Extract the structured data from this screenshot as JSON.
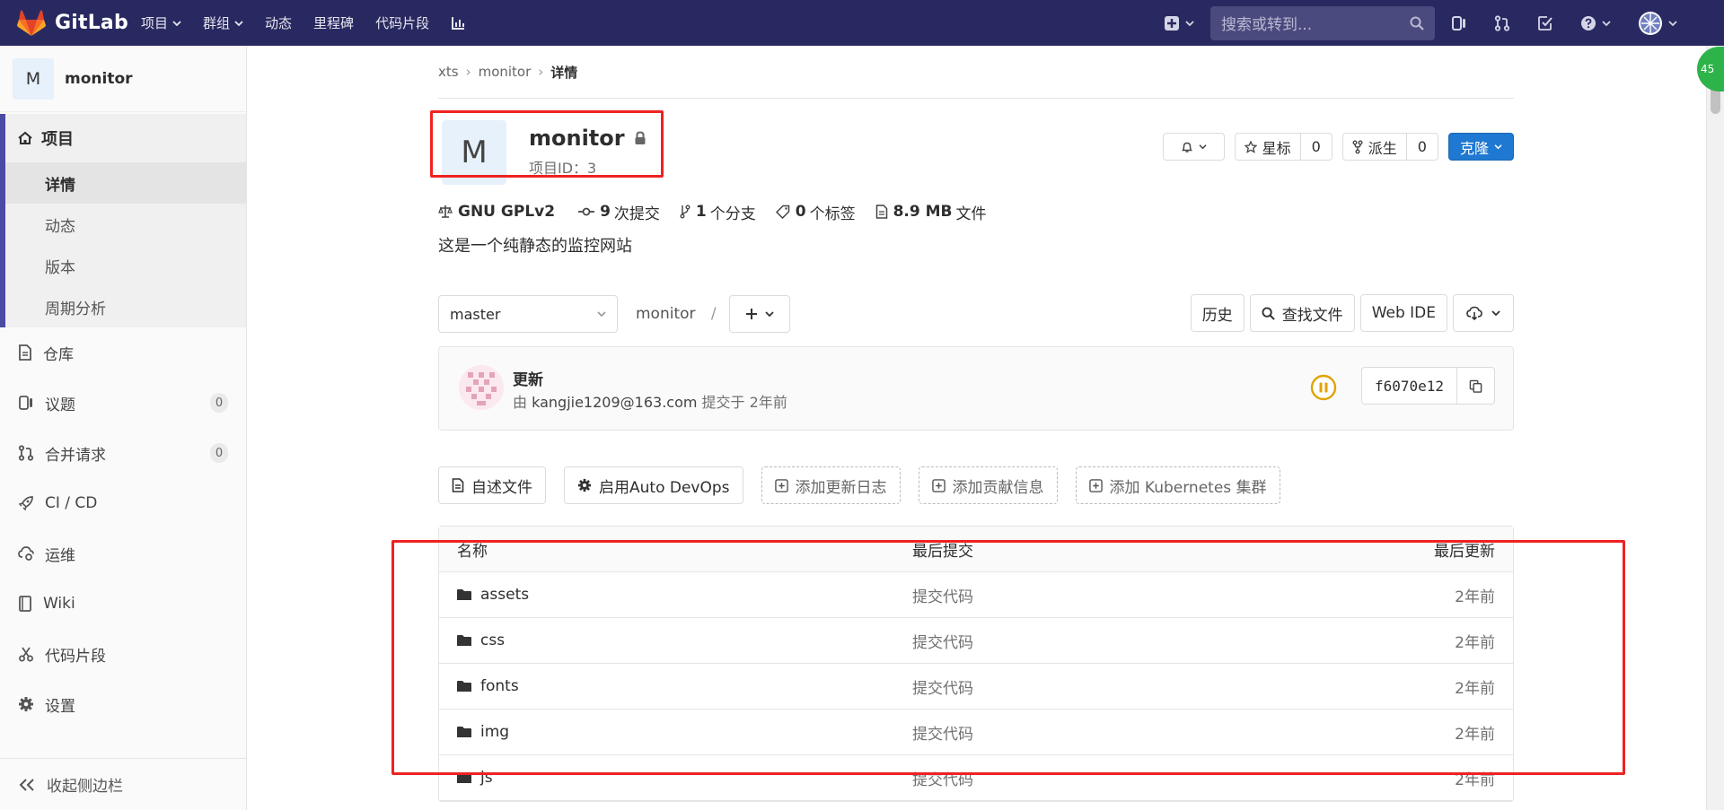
{
  "navbar": {
    "brand": "GitLab",
    "links": [
      "项目",
      "群组",
      "动态",
      "里程碑",
      "代码片段"
    ],
    "search_placeholder": "搜索或转到..."
  },
  "sidebar": {
    "avatar_letter": "M",
    "project_name": "monitor",
    "group_label": "项目",
    "sub_items": [
      "详情",
      "动态",
      "版本",
      "周期分析"
    ],
    "items": [
      {
        "label": "仓库"
      },
      {
        "label": "议题",
        "count": "0"
      },
      {
        "label": "合并请求",
        "count": "0"
      },
      {
        "label": "CI / CD"
      },
      {
        "label": "运维"
      },
      {
        "label": "Wiki"
      },
      {
        "label": "代码片段"
      },
      {
        "label": "设置"
      }
    ],
    "collapse_label": "收起侧边栏"
  },
  "breadcrumb": [
    "xts",
    "monitor",
    "详情"
  ],
  "project": {
    "avatar_letter": "M",
    "title": "monitor",
    "id_label": "项目ID：3",
    "star_label": "星标",
    "star_count": "0",
    "fork_label": "派生",
    "fork_count": "0",
    "clone_label": "克隆"
  },
  "stats": {
    "license": "GNU GPLv2",
    "commits_num": "9",
    "commits_label": "次提交",
    "branches_num": "1",
    "branches_label": "个分支",
    "tags_num": "0",
    "tags_label": "个标签",
    "size_num": "8.9 MB",
    "size_label": "文件"
  },
  "description": "这是一个纯静态的监控网站",
  "repo": {
    "branch": "master",
    "path": "monitor",
    "history": "历史",
    "find_file": "查找文件",
    "web_ide": "Web IDE"
  },
  "commit": {
    "title": "更新",
    "by": "由",
    "author": "kangjie1209@163.com",
    "when": "提交于 2年前",
    "sha": "f6070e12"
  },
  "quick_actions": {
    "readme": "自述文件",
    "autodevops": "启用Auto DevOps",
    "changelog": "添加更新日志",
    "contributing": "添加贡献信息",
    "kubernetes": "添加 Kubernetes 集群"
  },
  "table": {
    "headers": [
      "名称",
      "最后提交",
      "最后更新"
    ],
    "rows": [
      {
        "name": "assets",
        "commit": "提交代码",
        "updated": "2年前"
      },
      {
        "name": "css",
        "commit": "提交代码",
        "updated": "2年前"
      },
      {
        "name": "fonts",
        "commit": "提交代码",
        "updated": "2年前"
      },
      {
        "name": "img",
        "commit": "提交代码",
        "updated": "2年前"
      },
      {
        "name": "js",
        "commit": "提交代码",
        "updated": "2年前"
      }
    ]
  },
  "float_badge": "45"
}
